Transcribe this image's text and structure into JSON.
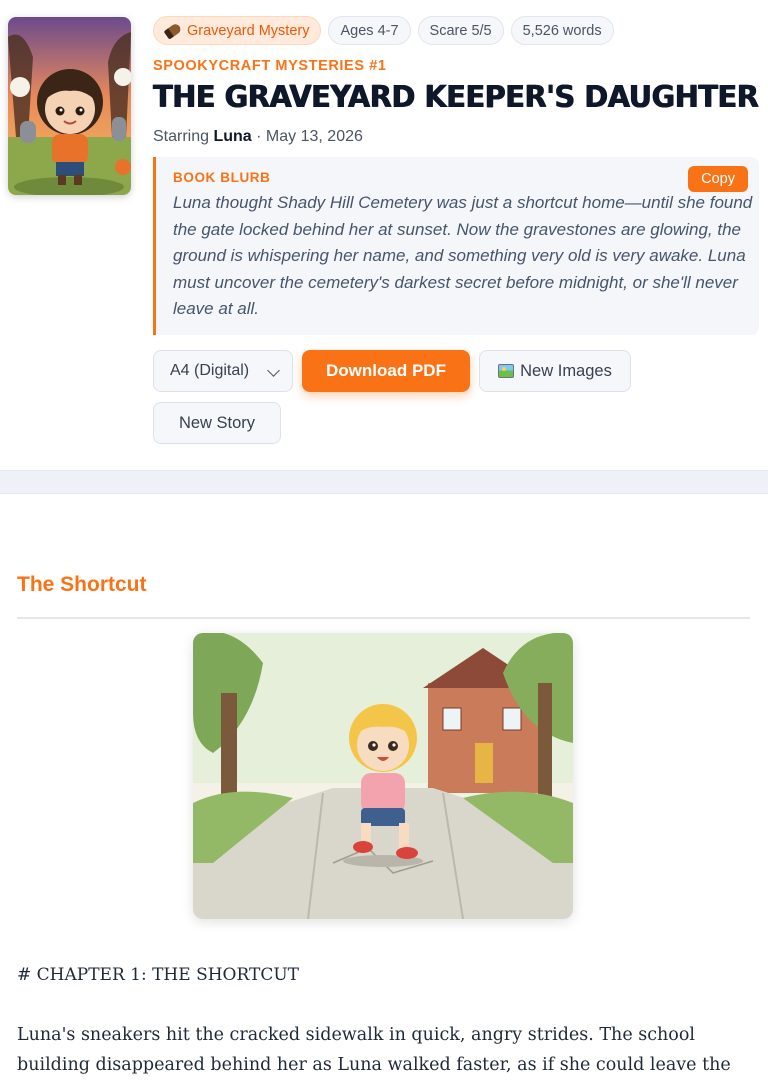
{
  "book": {
    "chips": {
      "genre": "Graveyard Mystery",
      "ages": "Ages 4-7",
      "scare": "Scare 5/5",
      "words": "5,526 words"
    },
    "series": "SPOOKYCRAFT MYSTERIES #1",
    "title": "THE GRAVEYARD KEEPER'S DAUGHTER",
    "starring_prefix": "Starring",
    "starring_name": "Luna",
    "date": "· May 13, 2026"
  },
  "blurb": {
    "label": "BOOK BLURB",
    "copy_label": "Copy",
    "text": "Luna thought Shady Hill Cemetery was just a shortcut home—until she found the gate locked behind her at sunset. Now the gravestones are glowing, the ground is whispering her name, and something very old is very awake. Luna must uncover the cemetery's darkest secret before midnight, or she'll never leave at all."
  },
  "actions": {
    "format_selected": "A4 (Digital)",
    "download_label": "Download PDF",
    "new_images_label": "New Images",
    "new_story_label": "New Story"
  },
  "content": {
    "chapter_title": "The Shortcut",
    "markdown_heading": "# CHAPTER 1: THE SHORTCUT",
    "paragraph": "Luna's sneakers hit the cracked sidewalk in quick, angry strides. The school building disappeared behind her as Luna walked faster, as if she could leave the whole day behind."
  },
  "colors": {
    "accent": "#f97316",
    "title": "#0f172a",
    "blurb_bg": "#f4f6fa"
  },
  "icons": {
    "genre_chip": "pencil-icon",
    "new_images": "framed-picture-icon",
    "format_select": "chevron-down-icon"
  }
}
